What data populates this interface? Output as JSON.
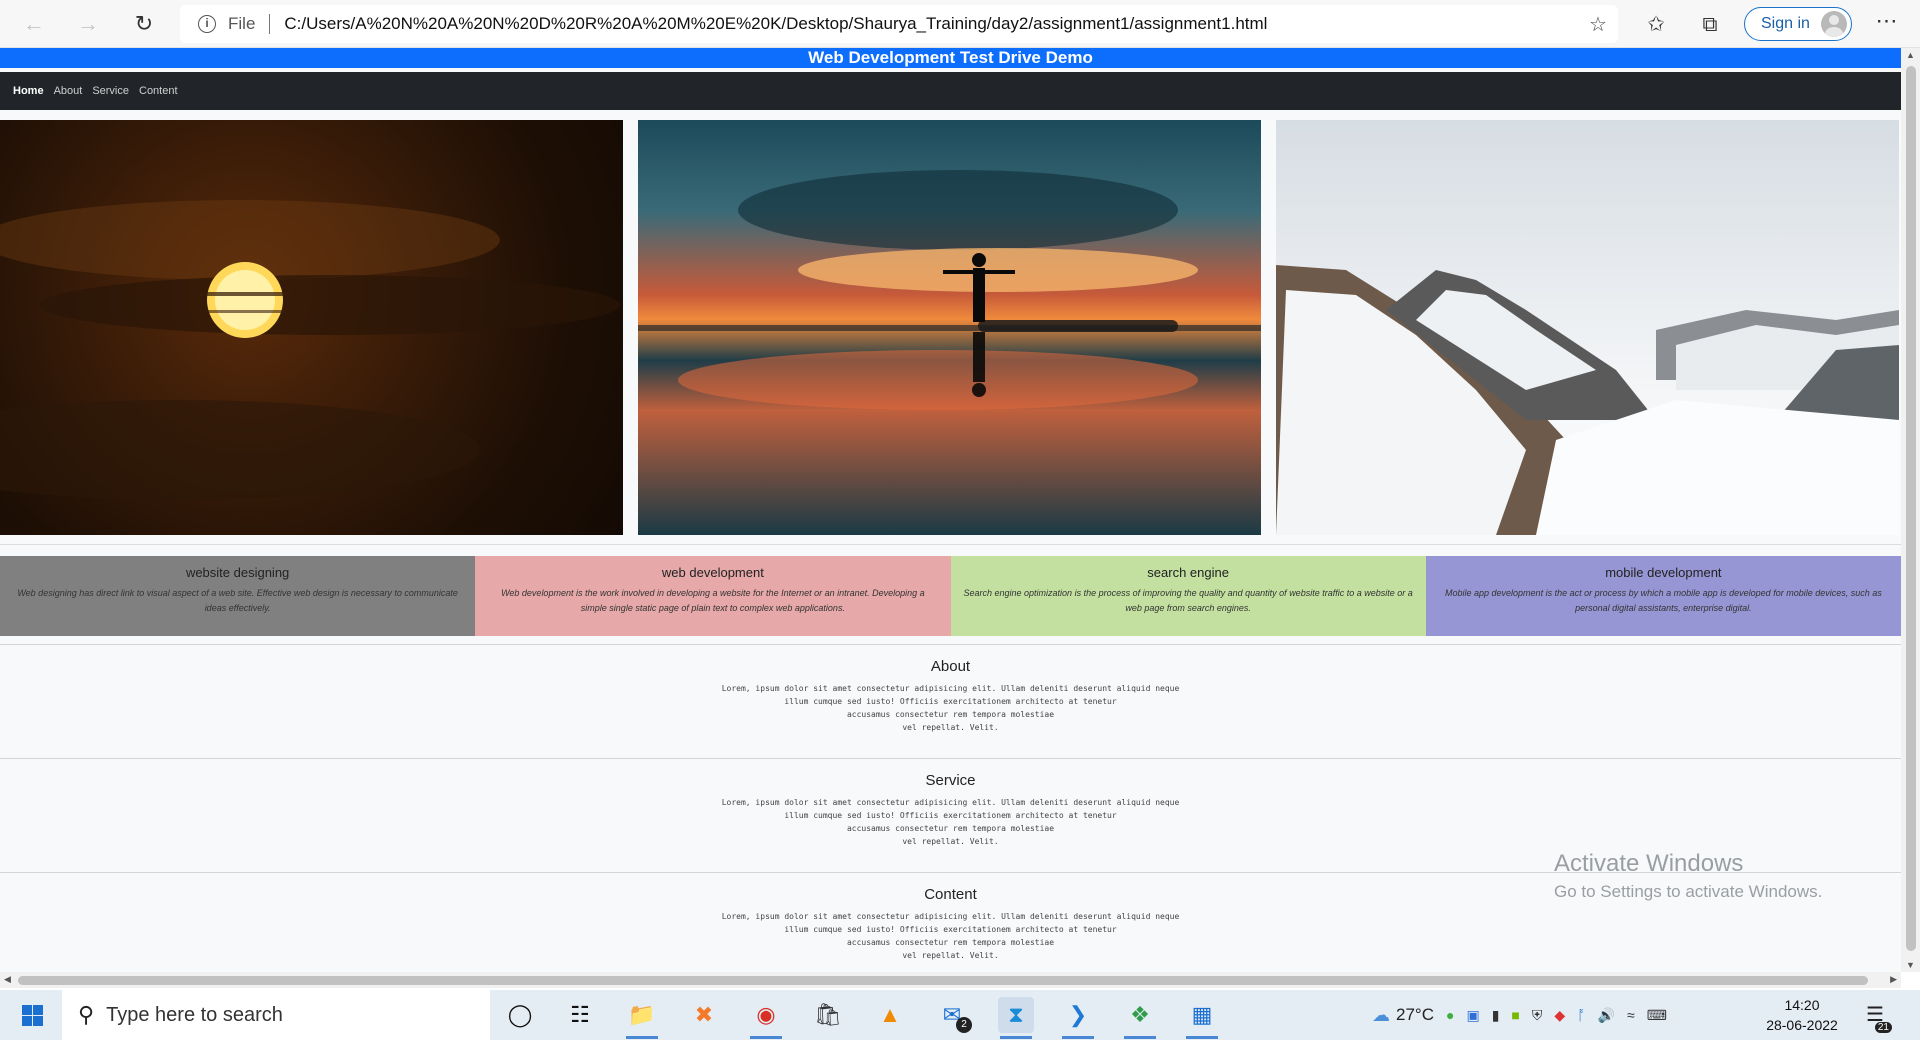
{
  "browser": {
    "file_label": "File",
    "url": "C:/Users/A%20N%20A%20N%20D%20R%20A%20M%20E%20K/Desktop/Shaurya_Training/day2/assignment1/assignment1.html",
    "sign_in": "Sign in"
  },
  "page": {
    "banner_title": "Web Development Test Drive Demo",
    "nav": [
      "Home",
      "About",
      "Service",
      "Content"
    ],
    "services": [
      {
        "title": "website designing",
        "desc": "Web designing has direct link to visual aspect of a web site. Effective web design is necessary to communicate ideas effectively."
      },
      {
        "title": "web development",
        "desc": "Web development is the work involved in developing a website for the Internet or an intranet. Developing a simple single static page of plain text to complex web applications."
      },
      {
        "title": "search engine",
        "desc": "Search engine optimization is the process of improving the quality and quantity of website traffic to a website or a web page from search engines."
      },
      {
        "title": "mobile development",
        "desc": "Mobile app development is the act or process by which a mobile app is developed for mobile devices, such as personal digital assistants, enterprise digital."
      }
    ],
    "sections": [
      {
        "title": "About",
        "lines": [
          "Lorem, ipsum dolor sit amet consectetur adipisicing elit. Ullam deleniti deserunt aliquid neque",
          "illum cumque sed iusto! Officiis exercitationem architecto at tenetur",
          "accusamus consectetur rem tempora molestiae",
          "vel repellat. Velit."
        ]
      },
      {
        "title": "Service",
        "lines": [
          "Lorem, ipsum dolor sit amet consectetur adipisicing elit. Ullam deleniti deserunt aliquid neque",
          "illum cumque sed iusto! Officiis exercitationem architecto at tenetur",
          "accusamus consectetur rem tempora molestiae",
          "vel repellat. Velit."
        ]
      },
      {
        "title": "Content",
        "lines": [
          "Lorem, ipsum dolor sit amet consectetur adipisicing elit. Ullam deleniti deserunt aliquid neque",
          "illum cumque sed iusto! Officiis exercitationem architecto at tenetur",
          "accusamus consectetur rem tempora molestiae",
          "vel repellat. Velit."
        ]
      }
    ]
  },
  "watermark": {
    "title": "Activate Windows",
    "subtitle": "Go to Settings to activate Windows."
  },
  "taskbar": {
    "search_placeholder": "Type here to search",
    "weather": "27°C",
    "time": "14:20",
    "date": "28-06-2022",
    "mail_badge": "2",
    "notification_count": "21"
  },
  "colors": {
    "banner": "#0d6efd",
    "navbar": "#212529",
    "service_1": "#808080",
    "service_2": "#e6a8a8",
    "service_3": "#c3e0a0",
    "service_4": "#9696d4"
  }
}
